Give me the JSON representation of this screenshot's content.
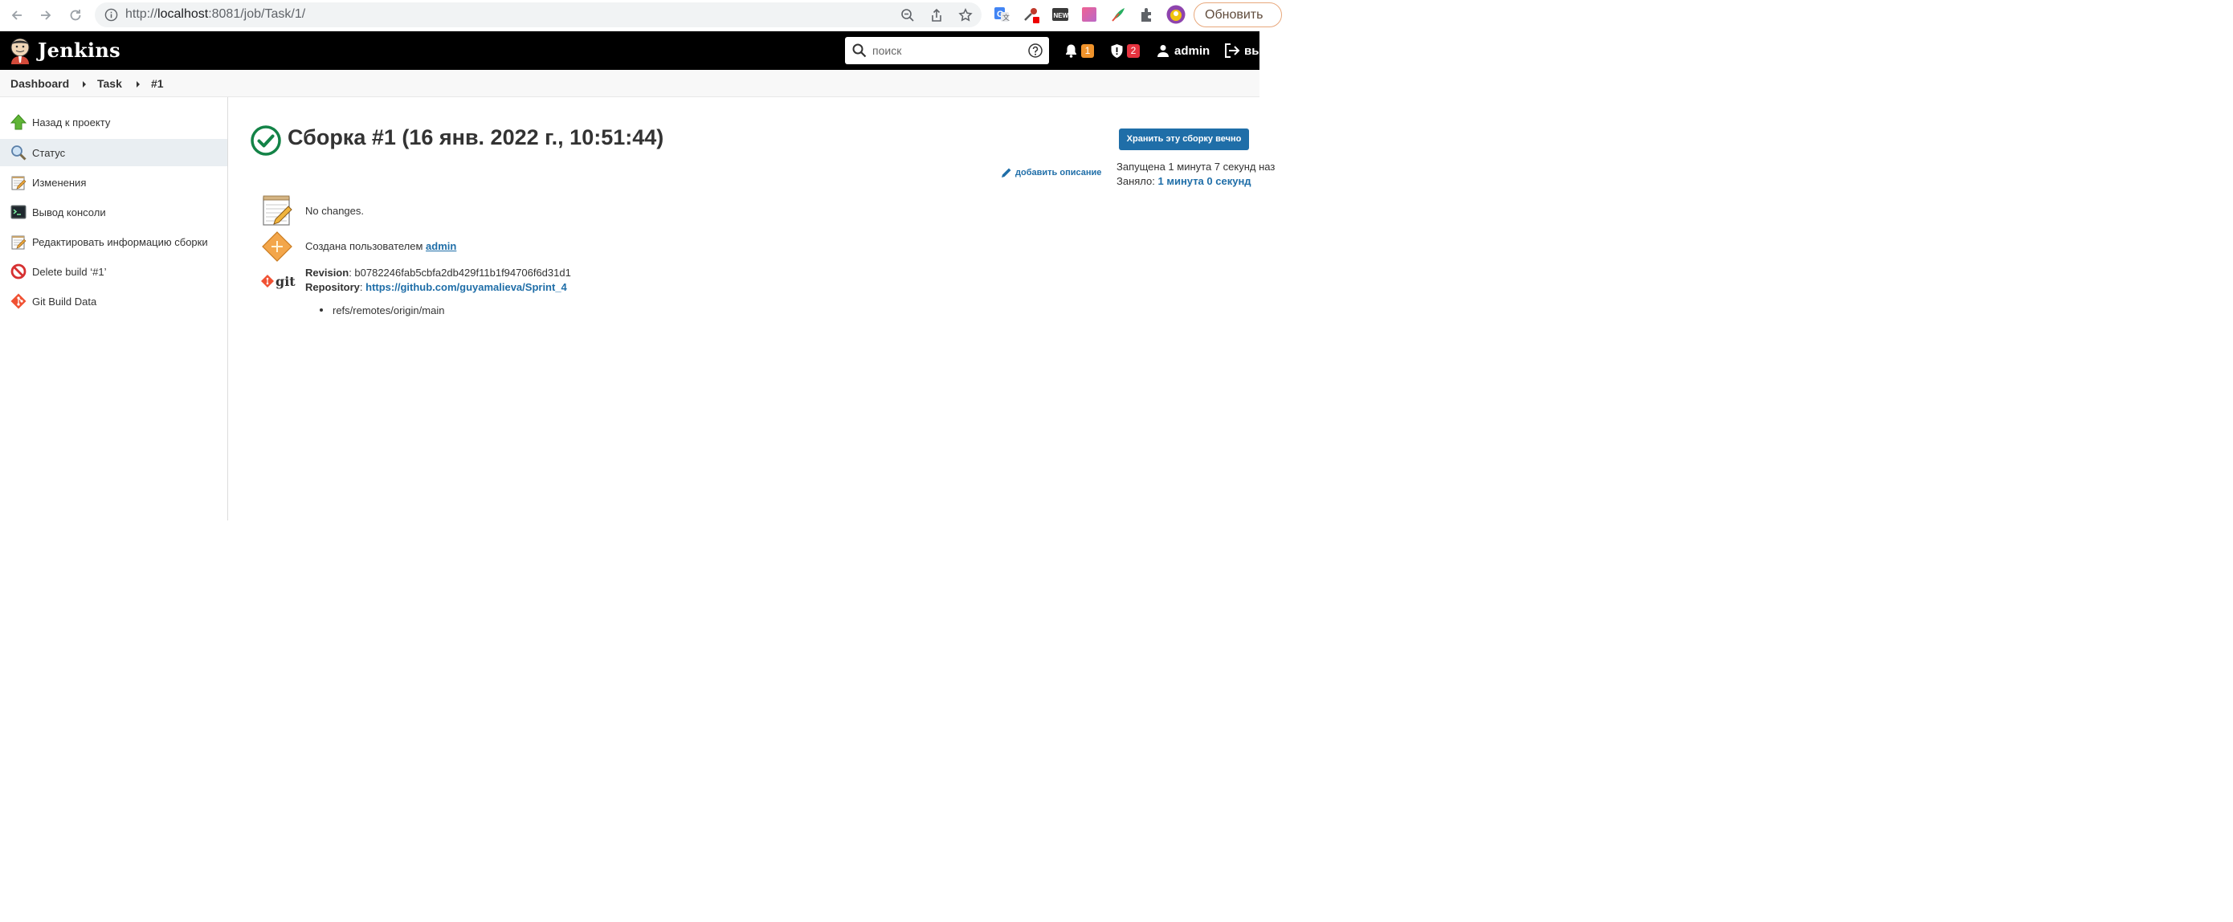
{
  "browser": {
    "url_scheme": "http://",
    "url_host": "localhost",
    "url_rest": ":8081/job/Task/1/",
    "update_label": "Обновить"
  },
  "header": {
    "app_name": "Jenkins",
    "search_placeholder": "поиск",
    "notifications_count": "1",
    "security_count": "2",
    "user": "admin",
    "logout_label": "вы"
  },
  "breadcrumb": {
    "items": [
      "Dashboard",
      "Task",
      "#1"
    ]
  },
  "sidebar": {
    "items": [
      {
        "label": "Назад к проекту",
        "icon": "up-arrow-icon"
      },
      {
        "label": "Статус",
        "icon": "magnifier-icon",
        "active": true
      },
      {
        "label": "Изменения",
        "icon": "notepad-icon"
      },
      {
        "label": "Вывод консоли",
        "icon": "terminal-icon"
      },
      {
        "label": "Редактировать информацию сборки",
        "icon": "notepad-icon"
      },
      {
        "label": "Delete build ‘#1’",
        "icon": "no-entry-icon"
      },
      {
        "label": "Git Build Data",
        "icon": "git-icon"
      }
    ]
  },
  "main": {
    "title": "Сборка #1 (16 янв. 2022 г., 10:51:44)",
    "status": "success",
    "keep_button": "Хранить эту сборку вечно",
    "add_description": "добавить описание",
    "started_text": "Запущена 1 минута 7 секунд наз",
    "duration_prefix": "Заняло: ",
    "duration_value": "1 минута 0 секунд",
    "changes_text": "No changes.",
    "created_by_prefix": "Создана пользователем ",
    "created_by_user": "admin",
    "revision_label": "Revision",
    "revision_value": ": b0782246fab5cbfa2db429f11b1f94706f6d31d1",
    "repository_label": "Repository",
    "repository_value": "https://github.com/guyamalieva/Sprint_4",
    "refs": "refs/remotes/origin/main"
  },
  "colors": {
    "jenkins_header": "#000000",
    "link": "#1f6ea8",
    "success": "#138347",
    "badge_orange": "#f0932b",
    "badge_red": "#e6333f"
  }
}
